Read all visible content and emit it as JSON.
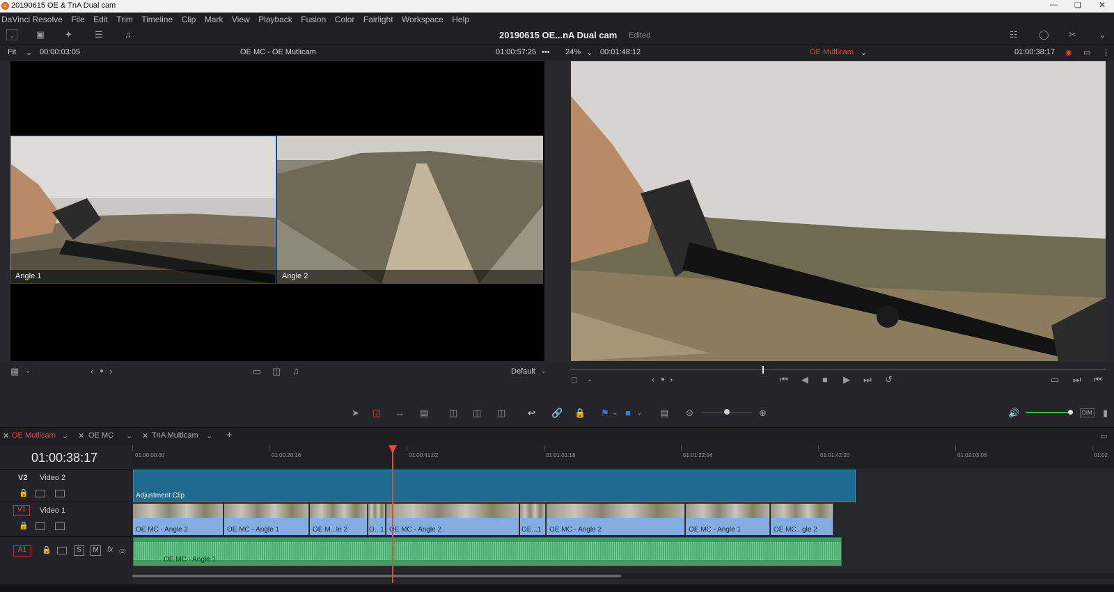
{
  "window": {
    "title": "20190615 OE & TnA Dual cam"
  },
  "menu": [
    "DaVinci Resolve",
    "File",
    "Edit",
    "Trim",
    "Timeline",
    "Clip",
    "Mark",
    "View",
    "Playback",
    "Fusion",
    "Color",
    "Fairlight",
    "Workspace",
    "Help"
  ],
  "header": {
    "project": "20190615 OE...nA Dual cam",
    "status": "Edited"
  },
  "source_viewer": {
    "zoom": "Fit",
    "duration": "00:00:03:05",
    "name": "OE MC - OE Mutlicam",
    "timecode": "01:00:57:25",
    "angles": [
      {
        "label": "Angle 1"
      },
      {
        "label": "Angle 2"
      }
    ],
    "layout_preset": "Default"
  },
  "timeline_viewer": {
    "zoom": "24%",
    "duration": "00:01:48:12",
    "name": "OE Mutlicam",
    "timecode": "01:00:38:17",
    "scrub_position": 0.36
  },
  "tabs": [
    {
      "label": "OE Mutlicam",
      "active": true
    },
    {
      "label": "OE MC",
      "active": false
    },
    {
      "label": "TnA Multicam",
      "active": false
    }
  ],
  "timeline": {
    "current_timecode": "01:00:38:17",
    "ruler": [
      "01:00:00:00",
      "01:00:20:16",
      "01:00:41:02",
      "01:01:01:18",
      "01:01:22:04",
      "01:01:42:20",
      "01:02:03:06",
      "01:02"
    ],
    "tracks": {
      "v2": {
        "id": "V2",
        "name": "Video 2",
        "clip": "Adjustment Clip"
      },
      "v1": {
        "id": "V1",
        "name": "Video 1",
        "clips": [
          "OE MC - Angle 2",
          "OE MC - Angle 1",
          "OE M...le 2",
          "O...1",
          "OE MC - Angle 2",
          "OE...1",
          "OE MC - Angle 2",
          "OE MC - Angle 1",
          "OE MC...gle 2"
        ]
      },
      "a1": {
        "id": "A1",
        "clip": "OE MC - Angle 1",
        "solo": "S",
        "mute": "M",
        "fx": "fx",
        "channels": "(2)"
      }
    },
    "audio_level_button": "DIM"
  },
  "colors": {
    "accent_red": "#e8453c",
    "clip_blue": "#82aee0",
    "adjust_blue": "#1f6a8f",
    "audio_green": "#3f9e62",
    "meter_green": "#3ebd45"
  }
}
